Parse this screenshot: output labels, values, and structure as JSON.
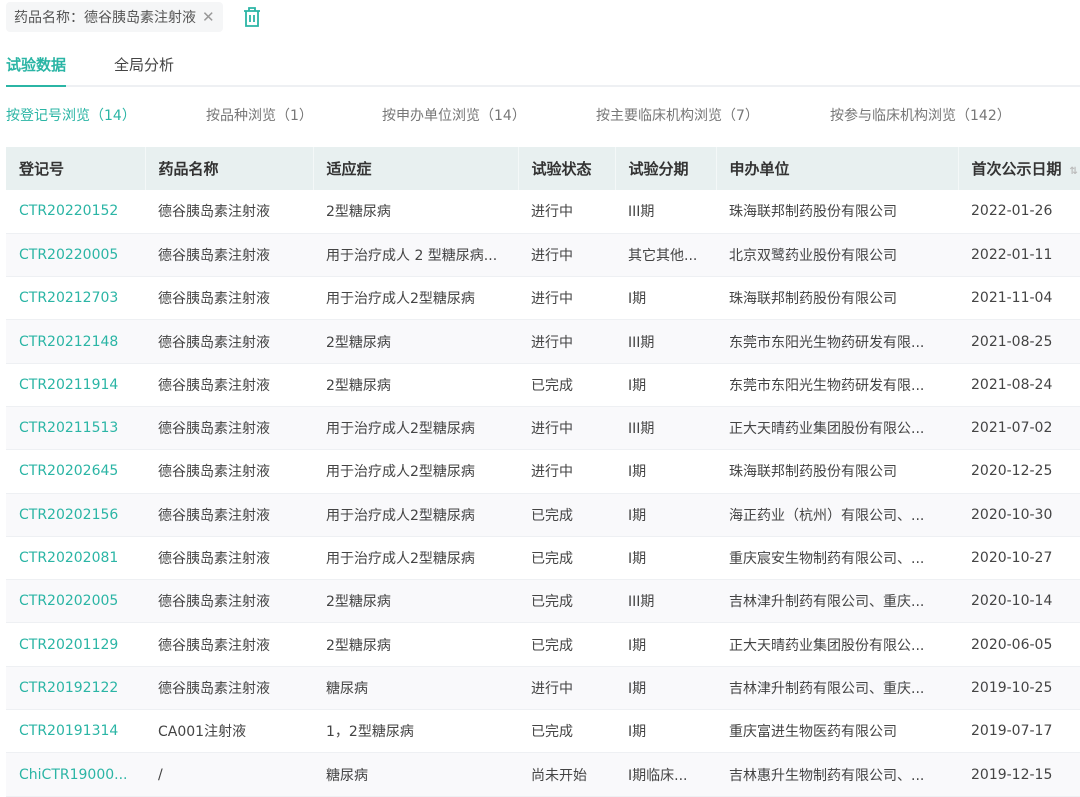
{
  "filter": {
    "label": "药品名称：德谷胰岛素注射液",
    "close_icon": "close-icon",
    "delete_icon": "trash-icon"
  },
  "accent": "#2bb5a5",
  "tabs": [
    {
      "label": "试验数据",
      "active": true
    },
    {
      "label": "全局分析",
      "active": false
    }
  ],
  "browse": [
    {
      "label": "按登记号浏览（14）",
      "active": true
    },
    {
      "label": "按品种浏览（1）"
    },
    {
      "label": "按申办单位浏览（14）"
    },
    {
      "label": "按主要临床机构浏览（7）"
    },
    {
      "label": "按参与临床机构浏览（142）"
    }
  ],
  "table": {
    "columns": [
      "登记号",
      "药品名称",
      "适应症",
      "试验状态",
      "试验分期",
      "申办单位",
      "首次公示日期"
    ],
    "rows": [
      [
        "CTR20220152",
        "德谷胰岛素注射液",
        "2型糖尿病",
        "进行中",
        "III期",
        "珠海联邦制药股份有限公司",
        "2022-01-26"
      ],
      [
        "CTR20220005",
        "德谷胰岛素注射液",
        "用于治疗成人 2 型糖尿病...",
        "进行中",
        "其它其他...",
        "北京双鹭药业股份有限公司",
        "2022-01-11"
      ],
      [
        "CTR20212703",
        "德谷胰岛素注射液",
        "用于治疗成人2型糖尿病",
        "进行中",
        "I期",
        "珠海联邦制药股份有限公司",
        "2021-11-04"
      ],
      [
        "CTR20212148",
        "德谷胰岛素注射液",
        "2型糖尿病",
        "进行中",
        "III期",
        "东莞市东阳光生物药研发有限...",
        "2021-08-25"
      ],
      [
        "CTR20211914",
        "德谷胰岛素注射液",
        "2型糖尿病",
        "已完成",
        "I期",
        "东莞市东阳光生物药研发有限...",
        "2021-08-24"
      ],
      [
        "CTR20211513",
        "德谷胰岛素注射液",
        "用于治疗成人2型糖尿病",
        "进行中",
        "III期",
        "正大天晴药业集团股份有限公...",
        "2021-07-02"
      ],
      [
        "CTR20202645",
        "德谷胰岛素注射液",
        "用于治疗成人2型糖尿病",
        "进行中",
        "I期",
        "珠海联邦制药股份有限公司",
        "2020-12-25"
      ],
      [
        "CTR20202156",
        "德谷胰岛素注射液",
        "用于治疗成人2型糖尿病",
        "已完成",
        "I期",
        "海正药业（杭州）有限公司、...",
        "2020-10-30"
      ],
      [
        "CTR20202081",
        "德谷胰岛素注射液",
        "用于治疗成人2型糖尿病",
        "已完成",
        "I期",
        "重庆宸安生物制药有限公司、...",
        "2020-10-27"
      ],
      [
        "CTR20202005",
        "德谷胰岛素注射液",
        "2型糖尿病",
        "已完成",
        "III期",
        "吉林津升制药有限公司、重庆...",
        "2020-10-14"
      ],
      [
        "CTR20201129",
        "德谷胰岛素注射液",
        "2型糖尿病",
        "已完成",
        "I期",
        "正大天晴药业集团股份有限公...",
        "2020-06-05"
      ],
      [
        "CTR20192122",
        "德谷胰岛素注射液",
        "糖尿病",
        "进行中",
        "I期",
        "吉林津升制药有限公司、重庆...",
        "2019-10-25"
      ],
      [
        "CTR20191314",
        "CA001注射液",
        "1，2型糖尿病",
        "已完成",
        "I期",
        "重庆富进生物医药有限公司",
        "2019-07-17"
      ],
      [
        "ChiCTR19000...",
        "/",
        "糖尿病",
        "尚未开始",
        "I期临床...",
        "吉林惠升生物制药有限公司、...",
        "2019-12-15"
      ]
    ]
  }
}
